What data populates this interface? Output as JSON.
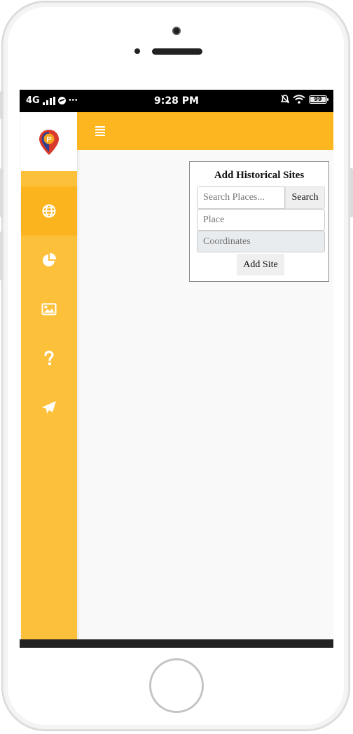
{
  "status_bar": {
    "network": "4G",
    "time": "9:28 PM",
    "battery": "99"
  },
  "sidebar": {
    "items": [
      {
        "icon": "globe-icon",
        "active": true
      },
      {
        "icon": "pie-chart-icon",
        "active": false
      },
      {
        "icon": "image-icon",
        "active": false
      },
      {
        "icon": "question-icon",
        "active": false
      },
      {
        "icon": "paper-plane-icon",
        "active": false
      }
    ]
  },
  "form": {
    "title": "Add Historical Sites",
    "search_placeholder": "Search Places...",
    "search_button": "Search",
    "place_placeholder": "Place",
    "coordinates_placeholder": "Coordinates",
    "add_button": "Add Site"
  },
  "colors": {
    "sidebar": "#fdc03b",
    "topbar": "#fdb61f",
    "active_item": "#fbb41e"
  }
}
